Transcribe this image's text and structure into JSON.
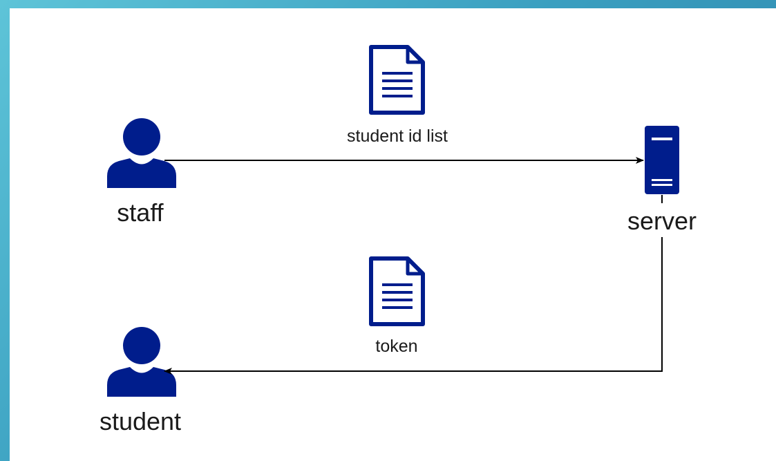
{
  "colors": {
    "icon": "#001d8c",
    "arrow": "#000000",
    "frame_gradient": [
      "#5ec4d8",
      "#2a7fa6"
    ]
  },
  "nodes": {
    "staff": {
      "label": "staff",
      "icon": "person-icon"
    },
    "student": {
      "label": "student",
      "icon": "person-icon"
    },
    "server": {
      "label": "server",
      "icon": "server-icon"
    }
  },
  "edges": {
    "staff_to_server": {
      "label": "student id list",
      "icon": "document-icon"
    },
    "server_to_student": {
      "label": "token",
      "icon": "document-icon"
    }
  }
}
